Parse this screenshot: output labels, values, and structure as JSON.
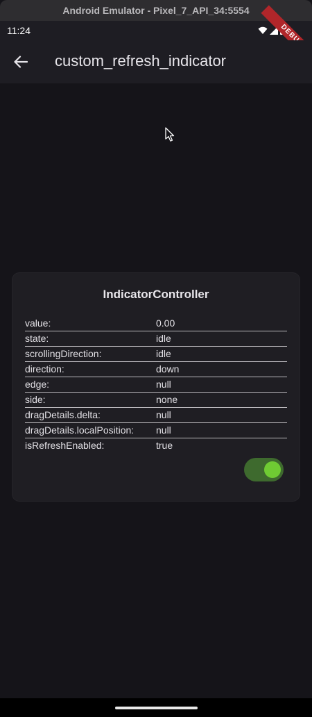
{
  "window": {
    "title": "Android Emulator - Pixel_7_API_34:5554"
  },
  "status_bar": {
    "time": "11:24",
    "debug_banner": "DEBUG"
  },
  "app_bar": {
    "back_icon": "arrow-left-icon",
    "title": "custom_refresh_indicator"
  },
  "card": {
    "title": "IndicatorController",
    "rows": [
      {
        "key": "value:",
        "value": "0.00"
      },
      {
        "key": "state:",
        "value": "idle"
      },
      {
        "key": "scrollingDirection:",
        "value": "idle"
      },
      {
        "key": "direction:",
        "value": "down"
      },
      {
        "key": "edge:",
        "value": "null"
      },
      {
        "key": "side:",
        "value": "none"
      },
      {
        "key": "dragDetails.delta:",
        "value": "null"
      },
      {
        "key": "dragDetails.localPosition:",
        "value": "null"
      },
      {
        "key": "isRefreshEnabled:",
        "value": "true"
      }
    ],
    "toggle_on": true
  },
  "colors": {
    "background": "#151419",
    "app_bar": "#1e1d23",
    "card": "#1f1e23",
    "toggle_track": "#3e6a2e",
    "toggle_thumb": "#6fcb33",
    "debug_banner": "#b0262a"
  }
}
